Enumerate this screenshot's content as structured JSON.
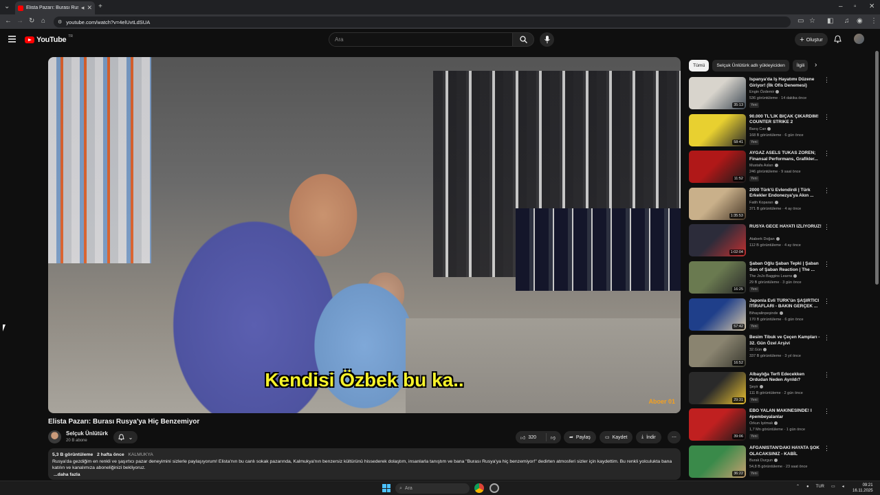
{
  "browser": {
    "tab_title": "Elista Pazarı: Burası Rusya'y",
    "url": "youtube.com/watch?v=4elUvtLdSUA"
  },
  "masthead": {
    "logo_text": "YouTube",
    "country_code": "TR",
    "search_placeholder": "Ara",
    "create_label": "Oluştur"
  },
  "video": {
    "subtitle": "Kendisi Özbek bu ka..",
    "watermark": "Aboer 01",
    "title": "Elista Pazarı: Burası Rusya'ya Hiç Benzemiyor"
  },
  "channel": {
    "name": "Selçuk Ünlütürk",
    "subs": "20 B abone"
  },
  "actions": {
    "likes": "320",
    "share": "Paylaş",
    "save": "Kaydet",
    "download": "İndir"
  },
  "description": {
    "views": "5,3 B görüntüleme",
    "age": "2 hafta önce",
    "tag": "KALMUKYA",
    "text": "Rusya'da gezdiğim en renkli ve şaşırtıcı pazar deneyimini sizlerle paylaşıyorum! Elista'nın bu canlı sokak pazarında, Kalmukya'nın benzersiz kültürünü hissederek dolaştım, insanlarla tanıştım ve bana \"Burası Rusya'ya hiç benzemiyor!\" dedirten atmosferi sizler için kaydettim. Bu renkli yolculukta bana katılın ve kanalımıza aboneliğinizi bekliyoruz.",
    "more": "...daha fazla"
  },
  "chips": [
    "Tümü",
    "Selçuk Ünlütürk adlı yükleyiciden",
    "İlgili"
  ],
  "recommendations": [
    {
      "title": "İspanya'da İş Hayatımı Düzene Giriyor! (İlk Ofis Denemesi)",
      "channel": "Engin Özdemir",
      "meta": "536 görüntüleme · 14 dakika önce",
      "badge": "Yeni",
      "duration": "35:13",
      "c1": "#d8d4cc",
      "c2": "#3f4a55"
    },
    {
      "title": "90.000 TL'LİK BIÇAK ÇIKARDIM! COUNTER STRIKE 2",
      "channel": "Barış Can",
      "meta": "168 B görüntüleme · 6 gün önce",
      "badge": "Yeni",
      "duration": "58:41",
      "c1": "#e8d030",
      "c2": "#2a2a2a"
    },
    {
      "title": "AYGAZ ASELS TUKAS ZOREN; Finansal Performans, Grafikler...",
      "channel": "Mustafa Aslan",
      "meta": "246 görüntüleme · 9 saat önce",
      "badge": "Yeni",
      "duration": "11:52",
      "c1": "#b01818",
      "c2": "#1a1a1a"
    },
    {
      "title": "2000 Türk'ü Evlendirdi | Türk Erkekler Endonezya'ya Akın ...",
      "channel": "Fatih Koparan",
      "meta": "371 B görüntüleme · 4 ay önce",
      "badge": "",
      "duration": "1:35:53",
      "c1": "#c9b08a",
      "c2": "#4a3a2a"
    },
    {
      "title": "RUSYA GECE HAYATI İZLİYORUZ!",
      "channel": "Ataberk Doğan",
      "meta": "112 B görüntüleme · 4 ay önce",
      "badge": "",
      "duration": "1:02:04",
      "c1": "#2c2c3a",
      "c2": "#c23030"
    },
    {
      "title": "Şaban Oğlu Şaban Tepki | Şaban Son of Şaban Reaction | The ...",
      "channel": "The JoJo Baggins Learns",
      "meta": "29 B görüntüleme · 3 gün önce",
      "badge": "Yeni",
      "duration": "16:25",
      "c1": "#6a7a50",
      "c2": "#2a2a2a"
    },
    {
      "title": "Japonla Evli TÜRK'ün ŞAŞIRTICI İTİRAFLARI - BAKIN GERÇEK ...",
      "channel": "Bihayalinpeşinde",
      "meta": "170 B görüntüleme · 6 gün önce",
      "badge": "Yeni",
      "duration": "57:42",
      "c1": "#1f3f8a",
      "c2": "#d8c8a8"
    },
    {
      "title": "Besim Tibuk ve Çeçen Kampları - 32. Gün Özel Arşivi",
      "channel": "32.Gün",
      "meta": "337 B görüntüleme · 3 yıl önce",
      "badge": "",
      "duration": "16:52",
      "c1": "#8a8470",
      "c2": "#3a3a30"
    },
    {
      "title": "Albaylığa Terfi Edecekken Ordudan Neden Ayrıldı?",
      "channel": "Şeyir",
      "meta": "111 B görüntüleme · 2 gün önce",
      "badge": "Yeni",
      "duration": "29:31",
      "c1": "#2a2a2a",
      "c2": "#e8c030"
    },
    {
      "title": "EBO YALAN MAKİNESİNDE! I #pembeyalanlar",
      "channel": "Orkun Işıtmak",
      "meta": "1,7 Mn görüntüleme · 1 gün önce",
      "badge": "Yeni",
      "duration": "39:06",
      "c1": "#c02020",
      "c2": "#1a1a1a"
    },
    {
      "title": "AFGANİSTAN'DAKİ HAYATA ŞOK OLACAKSINIZ - KABİL",
      "channel": "Burak Durgun",
      "meta": "54,8 B görüntüleme · 23 saat önce",
      "badge": "Yeni",
      "duration": "36:22",
      "c1": "#3a8a4a",
      "c2": "#c8a070"
    }
  ],
  "taskbar": {
    "search_placeholder": "Ara",
    "lang": "TUR",
    "time": "09:21",
    "date": "16.11.2025"
  }
}
